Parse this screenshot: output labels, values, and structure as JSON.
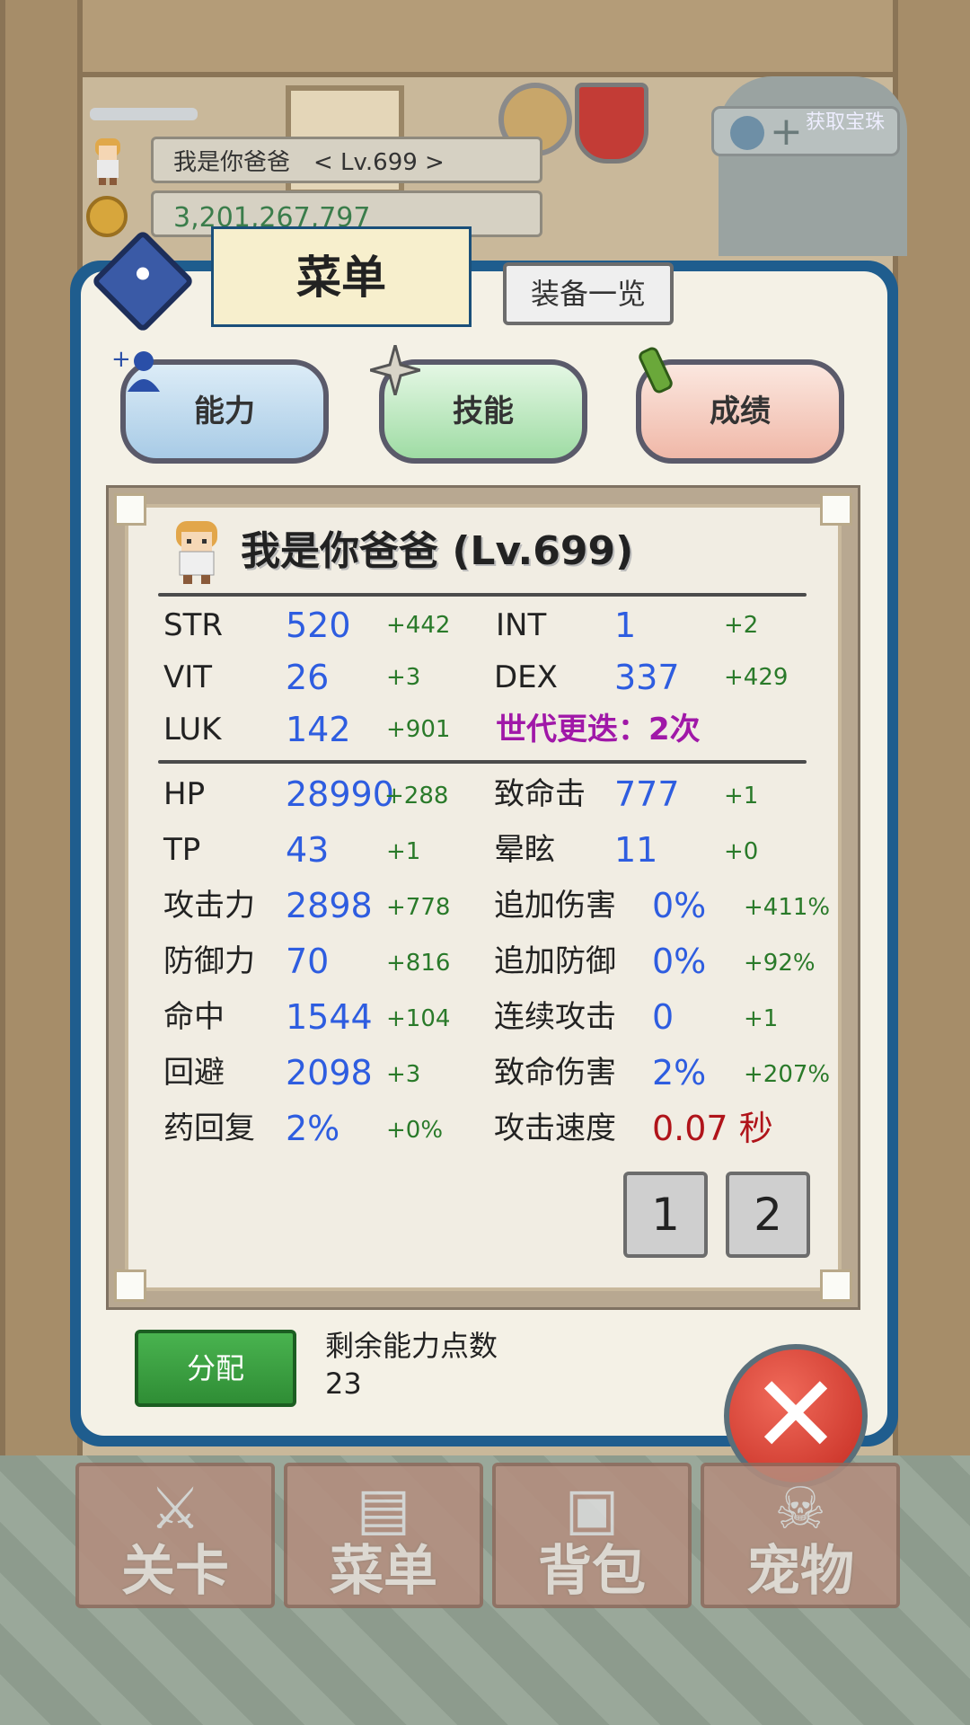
{
  "hud": {
    "player_name": "我是你爸爸　< Lv.699 >",
    "gold": "3,201,267,797",
    "pearl_label": "获取宝珠"
  },
  "dialog": {
    "menu_title": "菜单",
    "equip_list_label": "装备一览",
    "tabs": [
      {
        "label": "能力"
      },
      {
        "label": "技能"
      },
      {
        "label": "成绩"
      }
    ],
    "char_title": "我是你爸爸 (Lv.699)",
    "base_stats": [
      {
        "label": "STR",
        "value": "520",
        "bonus": "+442"
      },
      {
        "label": "INT",
        "value": "1",
        "bonus": "+2"
      },
      {
        "label": "VIT",
        "value": "26",
        "bonus": "+3"
      },
      {
        "label": "DEX",
        "value": "337",
        "bonus": "+429"
      },
      {
        "label": "LUK",
        "value": "142",
        "bonus": "+901"
      }
    ],
    "generation": "世代更迭：2次",
    "derived_left": [
      {
        "label": "HP",
        "value": "28990",
        "bonus": "+288"
      },
      {
        "label": "TP",
        "value": "43",
        "bonus": "+1"
      },
      {
        "label": "攻击力",
        "value": "2898",
        "bonus": "+778"
      },
      {
        "label": "防御力",
        "value": "70",
        "bonus": "+816"
      },
      {
        "label": "命中",
        "value": "1544",
        "bonus": "+104"
      },
      {
        "label": "回避",
        "value": "2098",
        "bonus": "+3"
      },
      {
        "label": "药回复",
        "value": "2%",
        "bonus": "+0%"
      }
    ],
    "derived_right": [
      {
        "label": "致命击",
        "value": "777",
        "bonus": "+1"
      },
      {
        "label": "晕眩",
        "value": "11",
        "bonus": "+0"
      },
      {
        "label": "追加伤害",
        "value": "0%",
        "bonus": "+411%"
      },
      {
        "label": "追加防御",
        "value": "0%",
        "bonus": "+92%"
      },
      {
        "label": "连续攻击",
        "value": "0",
        "bonus": "+1"
      },
      {
        "label": "致命伤害",
        "value": "2%",
        "bonus": "+207%"
      },
      {
        "label": "攻击速度",
        "value": "0.07 秒",
        "bonus": ""
      }
    ],
    "pages": [
      "1",
      "2"
    ],
    "assign_label": "分配",
    "remaining_points_label": "剩余能力点数",
    "remaining_points": "23"
  },
  "nav": [
    {
      "label": "关卡",
      "icon": "crossed-swords-icon"
    },
    {
      "label": "菜单",
      "icon": "book-icon"
    },
    {
      "label": "背包",
      "icon": "backpack-icon"
    },
    {
      "label": "宠物",
      "icon": "pet-skull-icon"
    }
  ],
  "colors": {
    "dialog_frame": "#1f5d8e",
    "value_blue": "#2e5de0",
    "bonus_green": "#2a7a2a",
    "generation_purple": "#a018a8",
    "speed_red": "#b0141a"
  }
}
